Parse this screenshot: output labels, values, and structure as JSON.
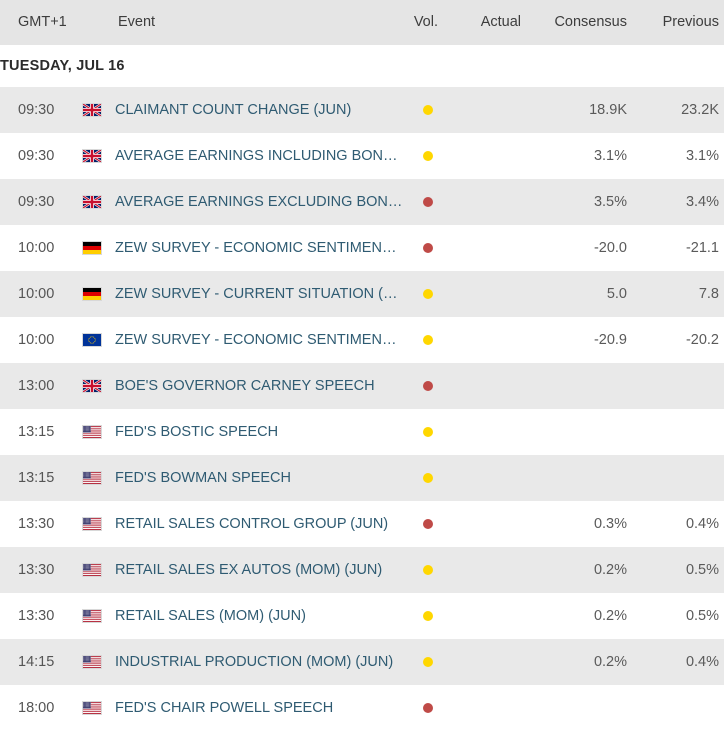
{
  "header": {
    "timezone": "GMT+1",
    "event": "Event",
    "vol": "Vol.",
    "actual": "Actual",
    "consensus": "Consensus",
    "previous": "Previous"
  },
  "date_group": {
    "label": "TUESDAY, JUL 16"
  },
  "colors": {
    "vol_low": "#ffd700",
    "vol_high": "#bf4a47",
    "link": "#2f5b72",
    "header_bg": "#e5e5e5",
    "row_alt_bg": "#e9e9e9"
  },
  "rows": [
    {
      "time": "09:30",
      "country": "uk",
      "event": "CLAIMANT COUNT CHANGE (JUN)",
      "vol": "low",
      "actual": "",
      "consensus": "18.9K",
      "previous": "23.2K"
    },
    {
      "time": "09:30",
      "country": "uk",
      "event": "AVERAGE EARNINGS INCLUDING BONUS (...",
      "vol": "low",
      "actual": "",
      "consensus": "3.1%",
      "previous": "3.1%"
    },
    {
      "time": "09:30",
      "country": "uk",
      "event": "AVERAGE EARNINGS EXCLUDING BONUS ...",
      "vol": "high",
      "actual": "",
      "consensus": "3.5%",
      "previous": "3.4%"
    },
    {
      "time": "10:00",
      "country": "de",
      "event": "ZEW SURVEY - ECONOMIC SENTIMENT (J...",
      "vol": "high",
      "actual": "",
      "consensus": "-20.0",
      "previous": "-21.1"
    },
    {
      "time": "10:00",
      "country": "de",
      "event": "ZEW SURVEY - CURRENT SITUATION (JUL)",
      "vol": "low",
      "actual": "",
      "consensus": "5.0",
      "previous": "7.8"
    },
    {
      "time": "10:00",
      "country": "eu",
      "event": "ZEW SURVEY - ECONOMIC SENTIMENT (J...",
      "vol": "low",
      "actual": "",
      "consensus": "-20.9",
      "previous": "-20.2"
    },
    {
      "time": "13:00",
      "country": "uk",
      "event": "BOE'S GOVERNOR CARNEY SPEECH",
      "vol": "high",
      "actual": "",
      "consensus": "",
      "previous": ""
    },
    {
      "time": "13:15",
      "country": "us",
      "event": "FED'S BOSTIC SPEECH",
      "vol": "low",
      "actual": "",
      "consensus": "",
      "previous": ""
    },
    {
      "time": "13:15",
      "country": "us",
      "event": "FED'S BOWMAN SPEECH",
      "vol": "low",
      "actual": "",
      "consensus": "",
      "previous": ""
    },
    {
      "time": "13:30",
      "country": "us",
      "event": "RETAIL SALES CONTROL GROUP (JUN)",
      "vol": "high",
      "actual": "",
      "consensus": "0.3%",
      "previous": "0.4%"
    },
    {
      "time": "13:30",
      "country": "us",
      "event": "RETAIL SALES EX AUTOS (MOM) (JUN)",
      "vol": "low",
      "actual": "",
      "consensus": "0.2%",
      "previous": "0.5%"
    },
    {
      "time": "13:30",
      "country": "us",
      "event": "RETAIL SALES (MOM) (JUN)",
      "vol": "low",
      "actual": "",
      "consensus": "0.2%",
      "previous": "0.5%"
    },
    {
      "time": "14:15",
      "country": "us",
      "event": "INDUSTRIAL PRODUCTION (MOM) (JUN)",
      "vol": "low",
      "actual": "",
      "consensus": "0.2%",
      "previous": "0.4%"
    },
    {
      "time": "18:00",
      "country": "us",
      "event": "FED'S CHAIR POWELL SPEECH",
      "vol": "high",
      "actual": "",
      "consensus": "",
      "previous": ""
    }
  ]
}
